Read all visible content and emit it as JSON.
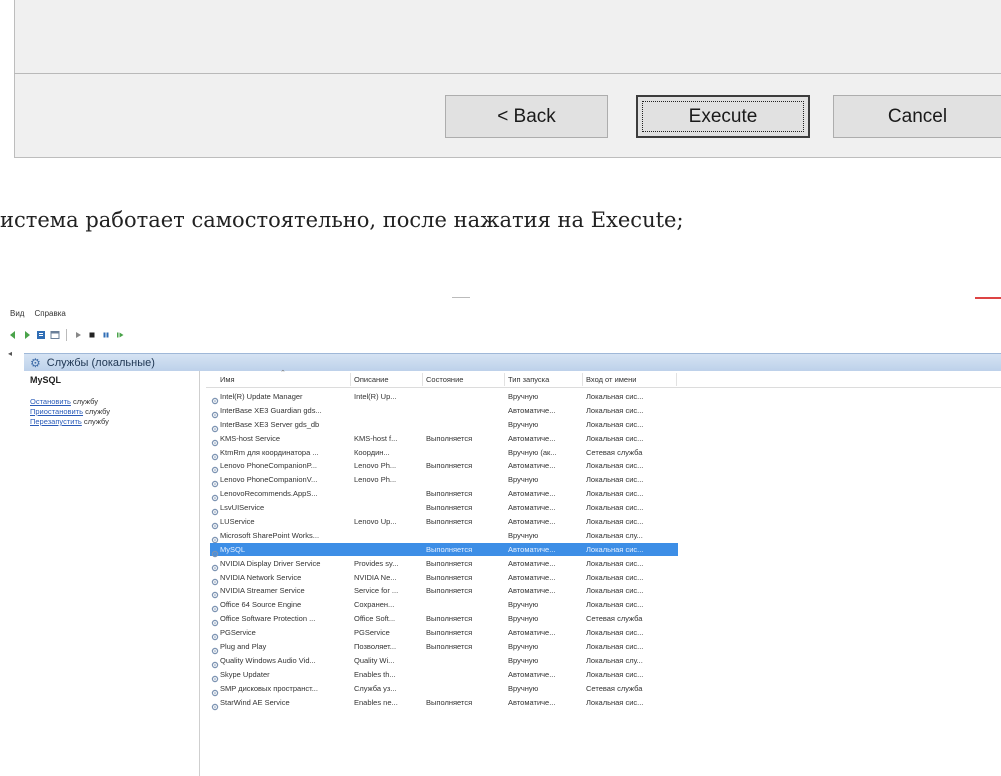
{
  "dialog": {
    "buttons": {
      "back": "< Back",
      "execute": "Execute",
      "cancel": "Cancel"
    }
  },
  "caption": "истема работает самостоятельно, после нажатия на Execute;",
  "services_window": {
    "menu": [
      "Вид",
      "Справка"
    ],
    "title": "Службы (локальные)",
    "left_pane": {
      "selected_service": "MySQL",
      "actions": [
        {
          "link": "Остановить",
          "rest": " службу"
        },
        {
          "link": "Приостановить",
          "rest": " службу"
        },
        {
          "link": "Перезапустить",
          "rest": " службу"
        }
      ]
    },
    "columns": {
      "name": "Имя",
      "description": "Описание",
      "state": "Состояние",
      "startup": "Тип запуска",
      "logon": "Вход от имени"
    },
    "rows": [
      {
        "name": "Intel(R) Update Manager",
        "description": "Intel(R) Up...",
        "state": "",
        "startup": "Вручную",
        "logon": "Локальная сис..."
      },
      {
        "name": "InterBase XE3 Guardian gds...",
        "description": "",
        "state": "",
        "startup": "Автоматиче...",
        "logon": "Локальная сис..."
      },
      {
        "name": "InterBase XE3 Server gds_db",
        "description": "",
        "state": "",
        "startup": "Вручную",
        "logon": "Локальная сис..."
      },
      {
        "name": "KMS-host Service",
        "description": "KMS-host f...",
        "state": "Выполняется",
        "startup": "Автоматиче...",
        "logon": "Локальная сис..."
      },
      {
        "name": "KtmRm для координатора ...",
        "description": "Координ...",
        "state": "",
        "startup": "Вручную (ак...",
        "logon": "Сетевая служба"
      },
      {
        "name": "Lenovo PhoneCompanionP...",
        "description": "Lenovo Ph...",
        "state": "Выполняется",
        "startup": "Автоматиче...",
        "logon": "Локальная сис..."
      },
      {
        "name": "Lenovo PhoneCompanionV...",
        "description": "Lenovo Ph...",
        "state": "",
        "startup": "Вручную",
        "logon": "Локальная сис..."
      },
      {
        "name": "LenovoRecommends.AppS...",
        "description": "",
        "state": "Выполняется",
        "startup": "Автоматиче...",
        "logon": "Локальная сис..."
      },
      {
        "name": "LsvUIService",
        "description": "",
        "state": "Выполняется",
        "startup": "Автоматиче...",
        "logon": "Локальная сис..."
      },
      {
        "name": "LUService",
        "description": "Lenovo Up...",
        "state": "Выполняется",
        "startup": "Автоматиче...",
        "logon": "Локальная сис..."
      },
      {
        "name": "Microsoft SharePoint Works...",
        "description": "",
        "state": "",
        "startup": "Вручную",
        "logon": "Локальная слу..."
      },
      {
        "name": "MySQL",
        "description": "",
        "state": "Выполняется",
        "startup": "Автоматиче...",
        "logon": "Локальная сис...",
        "selected": true
      },
      {
        "name": "NVIDIA Display Driver Service",
        "description": "Provides sy...",
        "state": "Выполняется",
        "startup": "Автоматиче...",
        "logon": "Локальная сис..."
      },
      {
        "name": "NVIDIA Network Service",
        "description": "NVIDIA Ne...",
        "state": "Выполняется",
        "startup": "Автоматиче...",
        "logon": "Локальная сис..."
      },
      {
        "name": "NVIDIA Streamer Service",
        "description": "Service for ...",
        "state": "Выполняется",
        "startup": "Автоматиче...",
        "logon": "Локальная сис..."
      },
      {
        "name": "Office 64 Source Engine",
        "description": "Сохранен...",
        "state": "",
        "startup": "Вручную",
        "logon": "Локальная сис..."
      },
      {
        "name": "Office Software Protection ...",
        "description": "Office Soft...",
        "state": "Выполняется",
        "startup": "Вручную",
        "logon": "Сетевая служба"
      },
      {
        "name": "PGService",
        "description": "PGService",
        "state": "Выполняется",
        "startup": "Автоматиче...",
        "logon": "Локальная сис..."
      },
      {
        "name": "Plug and Play",
        "description": "Позволяет...",
        "state": "Выполняется",
        "startup": "Вручную",
        "logon": "Локальная сис..."
      },
      {
        "name": "Quality Windows Audio Vid...",
        "description": "Quality Wi...",
        "state": "",
        "startup": "Вручную",
        "logon": "Локальная слу..."
      },
      {
        "name": "Skype Updater",
        "description": "Enables th...",
        "state": "",
        "startup": "Автоматиче...",
        "logon": "Локальная сис..."
      },
      {
        "name": "SMP дисковых пространст...",
        "description": "Служба уз...",
        "state": "",
        "startup": "Вручную",
        "logon": "Сетевая служба"
      },
      {
        "name": "StarWind AE Service",
        "description": "Enables ne...",
        "state": "Выполняется",
        "startup": "Автоматиче...",
        "logon": "Локальная сис..."
      }
    ]
  },
  "colors": {
    "dialog_bg": "#f0f0f0",
    "selection": "#3d8ee6",
    "title_bar": "#c9dbf0",
    "link": "#2a5bb8"
  }
}
